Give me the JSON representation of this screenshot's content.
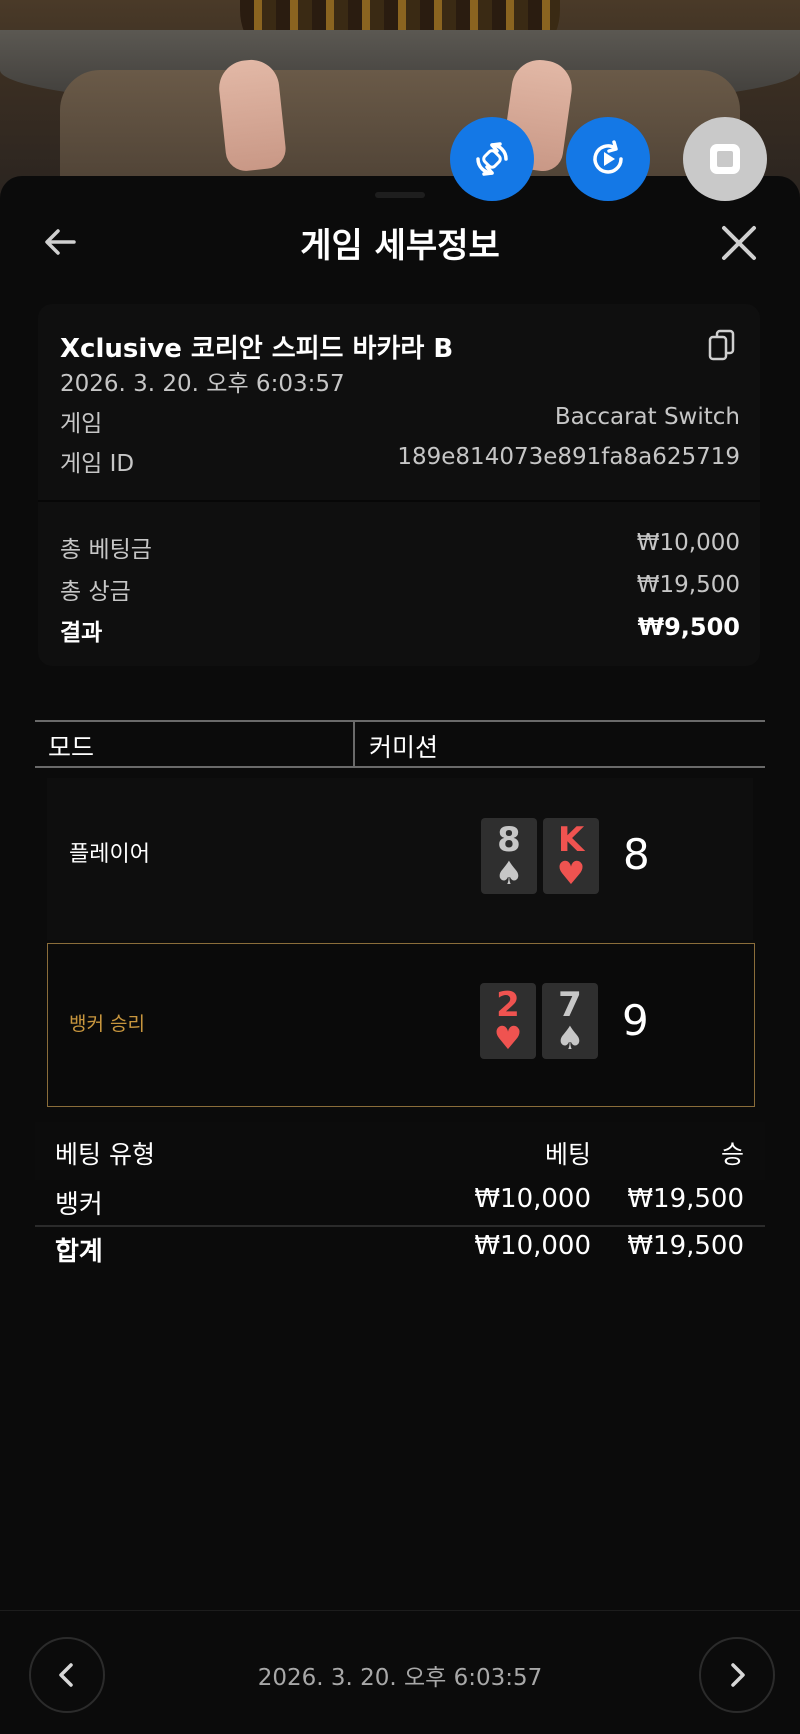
{
  "header": {
    "title": "게임 세부정보"
  },
  "game": {
    "name": "Xclusive 코리안 스피드 바카라 B",
    "datetime": "2026. 3. 20. 오후 6:03:57",
    "game_label": "게임",
    "game_value": "Baccarat Switch",
    "id_label": "게임 ID",
    "id_value": "189e814073e891fa8a625719"
  },
  "summary": {
    "total_bet_label": "총 베팅금",
    "total_bet_value": "₩10,000",
    "total_win_label": "총 상금",
    "total_win_value": "₩19,500",
    "result_label": "결과",
    "result_value": "₩9,500"
  },
  "mode": {
    "label": "모드",
    "value": "커미션"
  },
  "hands": {
    "player": {
      "label": "플레이어",
      "score": "8",
      "cards": [
        {
          "rank": "8",
          "suit": "♠",
          "color": "#c7c7c7"
        },
        {
          "rank": "K",
          "suit": "♥",
          "color": "#ef5350"
        }
      ]
    },
    "banker": {
      "label": "뱅커 승리",
      "score": "9",
      "highlight_color": "#c8963e",
      "cards": [
        {
          "rank": "2",
          "suit": "♥",
          "color": "#ef5350"
        },
        {
          "rank": "7",
          "suit": "♠",
          "color": "#c7c7c7"
        }
      ]
    }
  },
  "bets": {
    "columns": {
      "type": "베팅 유형",
      "bet": "베팅",
      "win": "승"
    },
    "rows": [
      {
        "type": "뱅커",
        "bet": "₩10,000",
        "win": "₩19,500"
      }
    ],
    "total": {
      "type": "합계",
      "bet": "₩10,000",
      "win": "₩19,500"
    }
  },
  "footer": {
    "datetime": "2026. 3. 20. 오후 6:03:57"
  },
  "icons": {
    "back": "arrow-left-icon",
    "close": "close-icon",
    "copy": "copy-icon",
    "prev": "chevron-left-icon",
    "next": "chevron-right-icon",
    "control_1": "rotate-sync-icon",
    "control_2": "replay-icon",
    "control_3": "stop-icon"
  },
  "colors": {
    "accent_blue": "#1478e6",
    "gold": "#c8963e"
  }
}
